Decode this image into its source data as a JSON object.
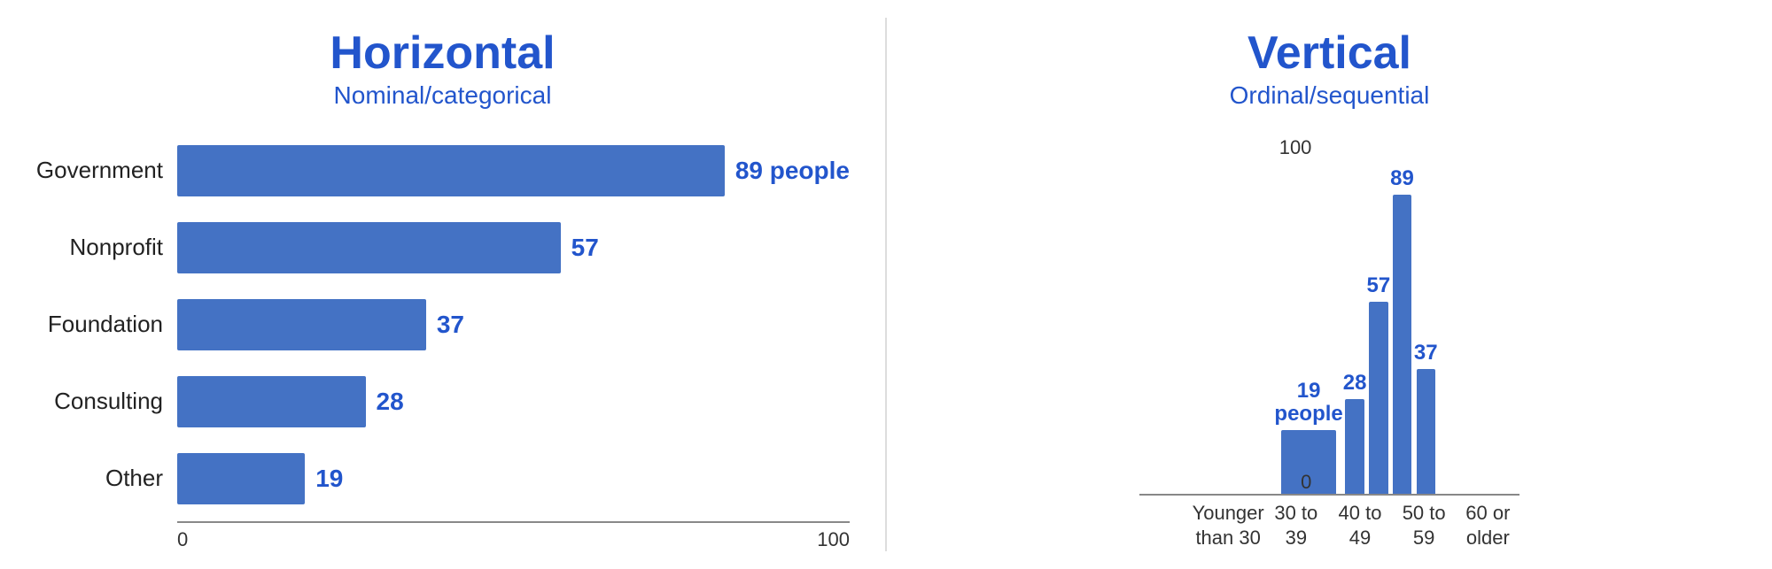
{
  "horizontal": {
    "title": "Horizontal",
    "subtitle": "Nominal/categorical",
    "bars": [
      {
        "label": "Government",
        "value": 89,
        "display": "89 people",
        "pct": 89
      },
      {
        "label": "Nonprofit",
        "value": 57,
        "display": "57",
        "pct": 57
      },
      {
        "label": "Foundation",
        "value": 37,
        "display": "37",
        "pct": 37
      },
      {
        "label": "Consulting",
        "value": 28,
        "display": "28",
        "pct": 28
      },
      {
        "label": "Other",
        "value": 19,
        "display": "19",
        "pct": 19
      }
    ],
    "axis_labels": [
      "0",
      "100"
    ]
  },
  "vertical": {
    "title": "Vertical",
    "subtitle": "Ordinal/sequential",
    "y_labels": [
      "100",
      ""
    ],
    "y_zero": "0",
    "bars": [
      {
        "label": "Younger\nthan 30",
        "value": 19,
        "display": "19\npeople",
        "pct": 19
      },
      {
        "label": "30 to 39",
        "value": 28,
        "display": "28",
        "pct": 28
      },
      {
        "label": "40 to 49",
        "value": 57,
        "display": "57",
        "pct": 57
      },
      {
        "label": "50 to 59",
        "value": 89,
        "display": "89",
        "pct": 89
      },
      {
        "label": "60 or\nolder",
        "value": 37,
        "display": "37",
        "pct": 37
      }
    ]
  },
  "colors": {
    "bar": "#4472c4",
    "title": "#2255cc",
    "text": "#222"
  }
}
